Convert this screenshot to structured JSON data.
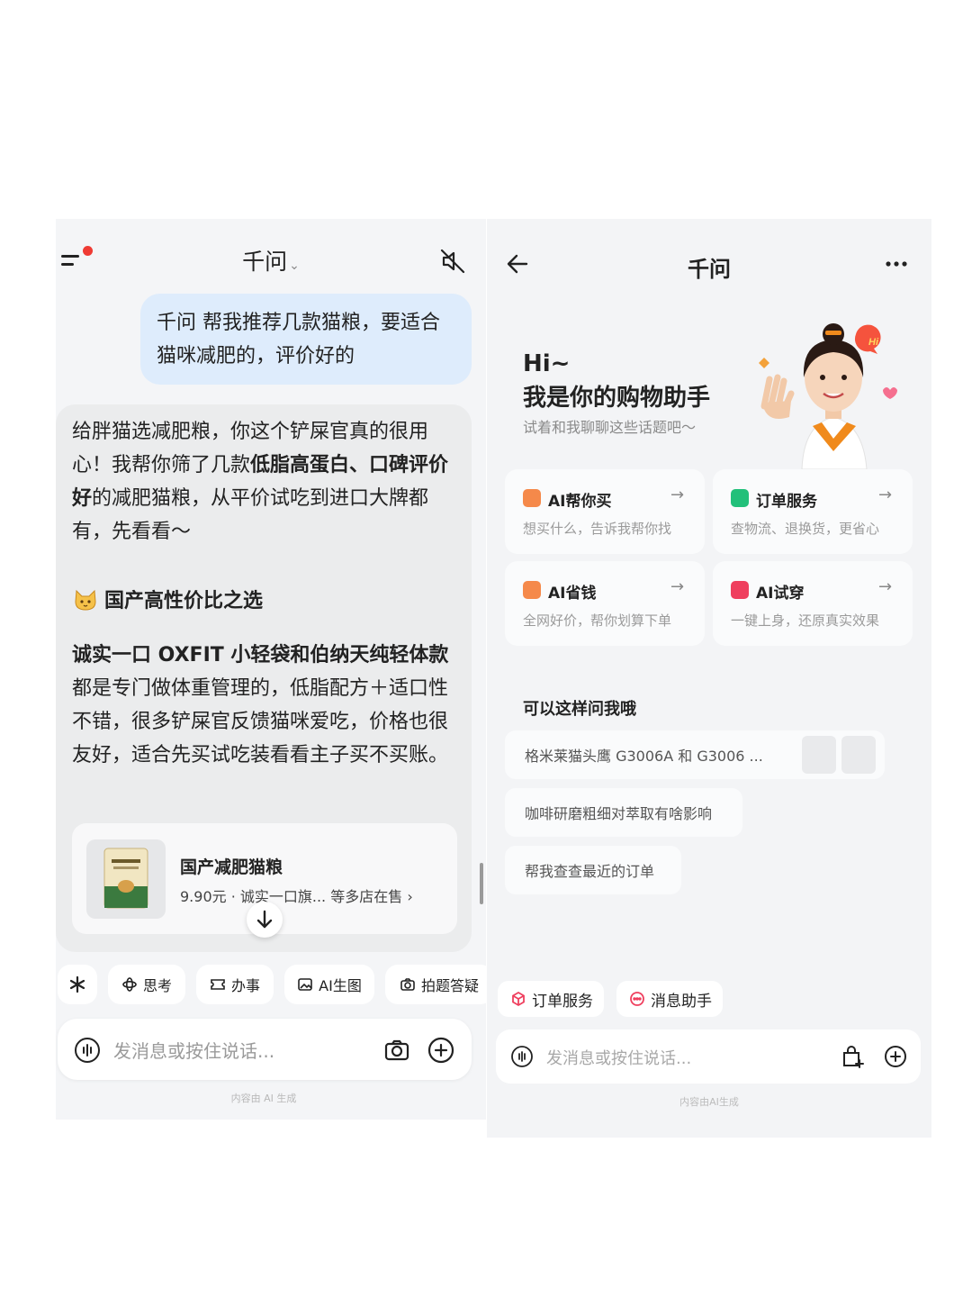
{
  "left": {
    "title": "千问",
    "user_message": "千问 帮我推荐几款猫粮，要适合猫咪减肥的，评价好的",
    "ai_intro_1": "给胖猫选减肥粮，你这个铲屎官真的很用心！我帮你筛了几款",
    "ai_intro_bold": "低脂高蛋白、口碑评价好",
    "ai_intro_2": "的减肥猫粮，从平价试吃到进口大牌都有，先看看～",
    "section_title": "国产高性价比之选",
    "body_bold": "诚实一口 OXFIT 小轻袋和伯纳天纯轻体款",
    "body_rest": "都是专门做体重管理的，低脂配方＋适口性不错，很多铲屎官反馈猫咪爱吃，价格也很友好，适合先买试吃装看看主子买不买账。",
    "product": {
      "name": "国产减肥猫粮",
      "meta": "9.90元 · 诚实一口旗...   等多店在售 ›"
    },
    "chips": [
      "思考",
      "办事",
      "AI生图",
      "拍题答疑"
    ],
    "input_placeholder": "发消息或按住说话...",
    "disclaimer": "内容由 AI 生成"
  },
  "right": {
    "title": "千问",
    "hi": "Hi~",
    "greeting": "我是你的购物助手",
    "greeting_sub": "试着和我聊聊这些话题吧～",
    "services": [
      {
        "title": "AI帮你买",
        "desc": "想买什么，告诉我帮你找",
        "color": "#f5894a"
      },
      {
        "title": "订单服务",
        "desc": "查物流、退换货，更省心",
        "color": "#22c07a"
      },
      {
        "title": "AI省钱",
        "desc": "全网好价，帮你划算下单",
        "color": "#f5894a"
      },
      {
        "title": "AI试穿",
        "desc": "一键上身，还原真实效果",
        "color": "#ef3f5e"
      }
    ],
    "ask_title": "可以这样问我哦",
    "suggestions": [
      "格米莱猫头鹰 G3006A 和 G3006 ...",
      "咖啡研磨粗细对萃取有啥影响",
      "帮我查查最近的订单"
    ],
    "chips": [
      "订单服务",
      "消息助手"
    ],
    "input_placeholder": "发消息或按住说话...",
    "disclaimer": "内容由AI生成",
    "arrow_glyph": "→"
  }
}
